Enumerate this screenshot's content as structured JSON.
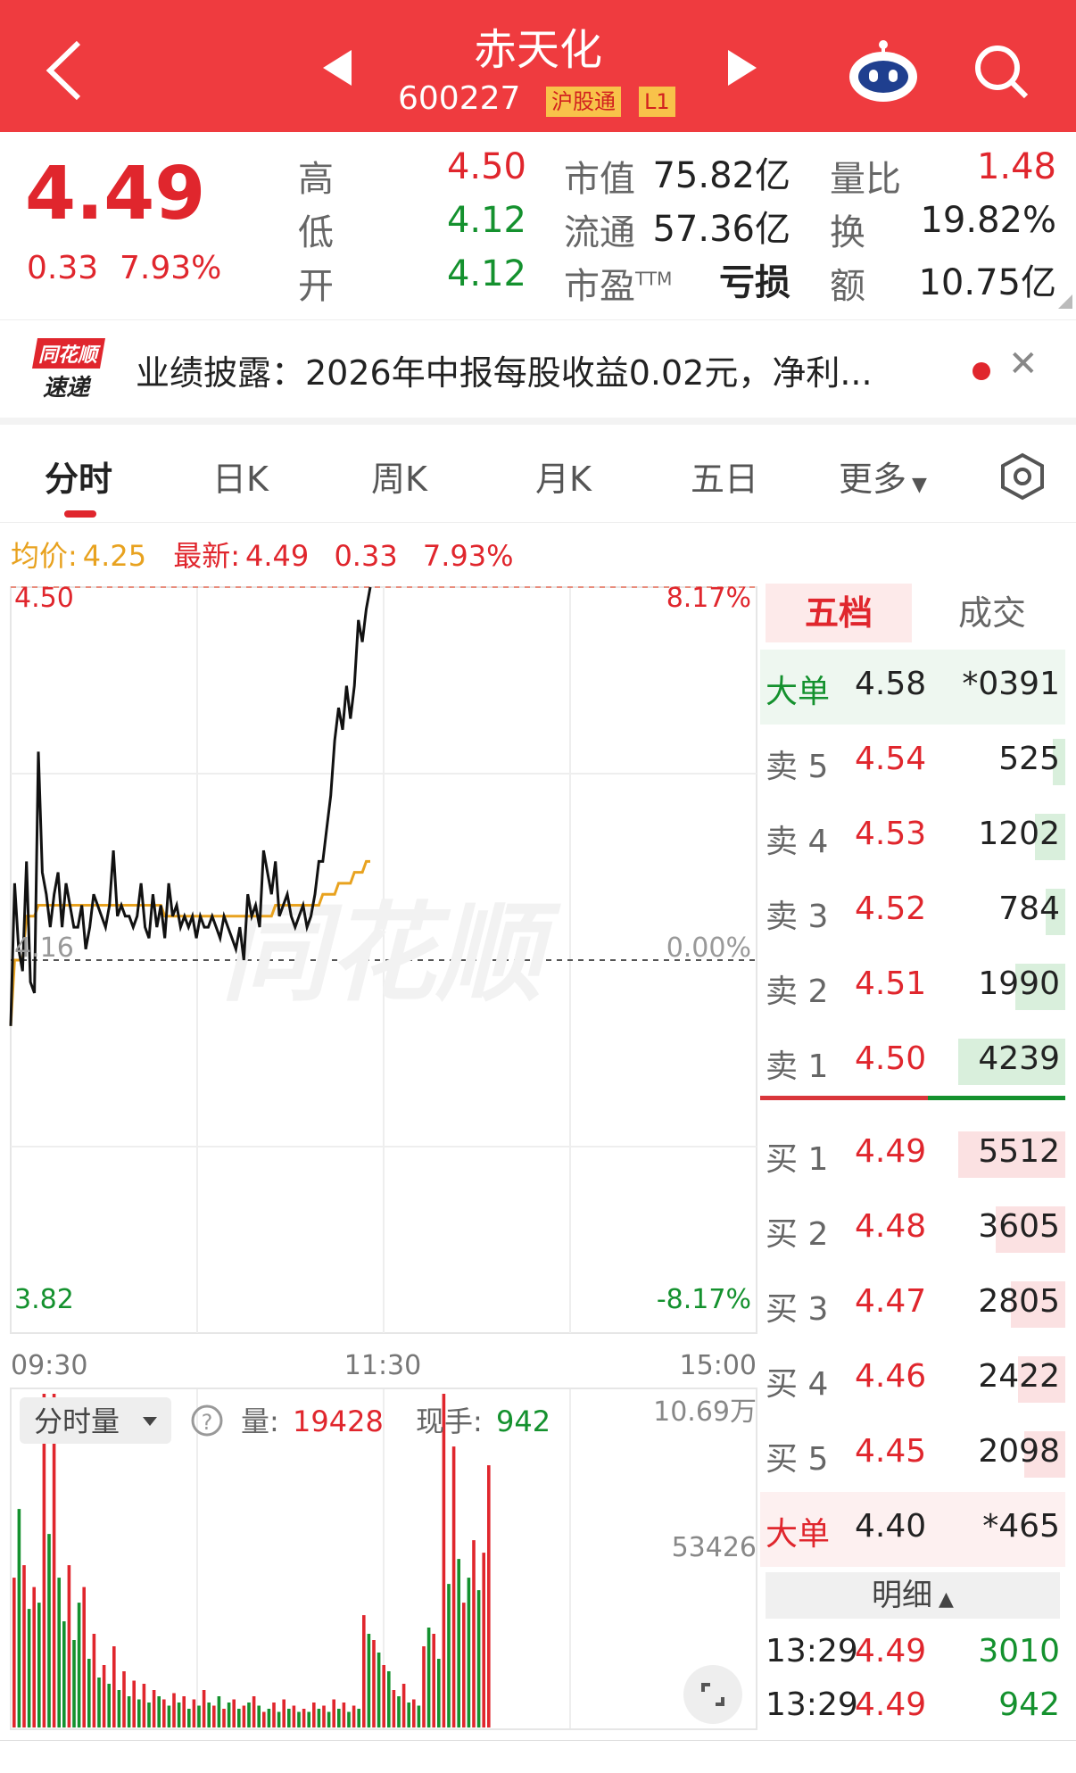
{
  "header": {
    "stock_name": "赤天化",
    "stock_code": "600227",
    "tag_connect": "沪股通",
    "tag_level": "L1"
  },
  "quote": {
    "price": "4.49",
    "change": "0.33",
    "change_pct": "7.93%",
    "high_label": "高",
    "high": "4.50",
    "low_label": "低",
    "low": "4.12",
    "open_label": "开",
    "open": "4.12",
    "mcap_label": "市值",
    "mcap": "75.82亿",
    "float_label": "流通",
    "float": "57.36亿",
    "pe_label": "市盈",
    "pe_sup": "TTM",
    "pe": "亏损",
    "vol_ratio_label": "量比",
    "vol_ratio": "1.48",
    "turnover_label": "换",
    "turnover": "19.82%",
    "amount_label": "额",
    "amount": "10.75亿"
  },
  "news": {
    "logo_line1": "同花顺",
    "logo_line2": "速递",
    "text": "业绩披露：2026年中报每股收益0.02元，净利..."
  },
  "tabs": [
    "分时",
    "日K",
    "周K",
    "月K",
    "五日",
    "更多"
  ],
  "avg_line": {
    "avg_label": "均价:",
    "avg_value": "4.25",
    "latest_label": "最新:",
    "latest_value": "4.49",
    "latest_change": "0.33",
    "latest_pct": "7.93%"
  },
  "chart_data": {
    "type": "line",
    "title": "",
    "ylim": [
      3.82,
      4.5
    ],
    "prev_close": 4.16,
    "y_labels_left": [
      "4.50",
      "4.16",
      "3.82"
    ],
    "y_labels_right": [
      "8.17%",
      "0.00%",
      "-8.17%"
    ],
    "x_labels": [
      "09:30",
      "11:30",
      "15:00"
    ],
    "series": [
      {
        "values": [
          4.1,
          4.23,
          4.17,
          4.15,
          4.25,
          4.14,
          4.13,
          4.35,
          4.24,
          4.22,
          4.19,
          4.22,
          4.24,
          4.19,
          4.23,
          4.21,
          4.19,
          4.19,
          4.21,
          4.17,
          4.19,
          4.22,
          4.21,
          4.2,
          4.19,
          4.21,
          4.26,
          4.2,
          4.21,
          4.2,
          4.2,
          4.19,
          4.2,
          4.23,
          4.19,
          4.18,
          4.22,
          4.19,
          4.21,
          4.18,
          4.23,
          4.2,
          4.21,
          4.19,
          4.2,
          4.19,
          4.2,
          4.18,
          4.2,
          4.19,
          4.19,
          4.2,
          4.19,
          4.18,
          4.2,
          4.19,
          4.18,
          4.17,
          4.19,
          4.16,
          4.22,
          4.2,
          4.21,
          4.19,
          4.26,
          4.24,
          4.22,
          4.25,
          4.2,
          4.21,
          4.22,
          4.2,
          4.19,
          4.2,
          4.21,
          4.19,
          4.2,
          4.22,
          4.25,
          4.25,
          4.28,
          4.31,
          4.36,
          4.39,
          4.37,
          4.41,
          4.38,
          4.41,
          4.47,
          4.45,
          4.48,
          4.5
        ],
        "avg": [
          4.1,
          4.16,
          4.16,
          4.16,
          4.2,
          4.2,
          4.2,
          4.21,
          4.21,
          4.21,
          4.21,
          4.21,
          4.21,
          4.21,
          4.21,
          4.21,
          4.21,
          4.21,
          4.21,
          4.21,
          4.21,
          4.21,
          4.21,
          4.21,
          4.21,
          4.21,
          4.21,
          4.21,
          4.21,
          4.21,
          4.21,
          4.21,
          4.21,
          4.21,
          4.21,
          4.21,
          4.21,
          4.21,
          4.21,
          4.2,
          4.2,
          4.2,
          4.2,
          4.2,
          4.2,
          4.2,
          4.2,
          4.2,
          4.2,
          4.2,
          4.2,
          4.2,
          4.2,
          4.2,
          4.2,
          4.2,
          4.2,
          4.2,
          4.2,
          4.2,
          4.2,
          4.2,
          4.2,
          4.2,
          4.2,
          4.2,
          4.2,
          4.21,
          4.21,
          4.21,
          4.21,
          4.21,
          4.21,
          4.21,
          4.21,
          4.21,
          4.21,
          4.21,
          4.21,
          4.22,
          4.22,
          4.22,
          4.22,
          4.23,
          4.23,
          4.23,
          4.23,
          4.24,
          4.24,
          4.24,
          4.25,
          4.25
        ]
      }
    ],
    "total_points": 241,
    "volume": {
      "selector_label": "分时量",
      "vol_label": "量:",
      "vol_value": "19428",
      "now_label": "现手:",
      "now_value": "942",
      "axis_top": "10.69万",
      "axis_mid": "53426",
      "max": 106900,
      "bars": [
        [
          48000,
          "r"
        ],
        [
          70000,
          "g"
        ],
        [
          52000,
          "r"
        ],
        [
          38000,
          "g"
        ],
        [
          45000,
          "r"
        ],
        [
          40000,
          "g"
        ],
        [
          106900,
          "r"
        ],
        [
          62000,
          "g"
        ],
        [
          106900,
          "r"
        ],
        [
          48000,
          "g"
        ],
        [
          34000,
          "g"
        ],
        [
          52000,
          "r"
        ],
        [
          28000,
          "g"
        ],
        [
          40000,
          "g"
        ],
        [
          45000,
          "r"
        ],
        [
          22000,
          "g"
        ],
        [
          30000,
          "r"
        ],
        [
          16000,
          "g"
        ],
        [
          20000,
          "r"
        ],
        [
          14000,
          "g"
        ],
        [
          26000,
          "r"
        ],
        [
          12000,
          "g"
        ],
        [
          18000,
          "r"
        ],
        [
          10000,
          "g"
        ],
        [
          15000,
          "r"
        ],
        [
          9000,
          "g"
        ],
        [
          14000,
          "r"
        ],
        [
          8000,
          "g"
        ],
        [
          12000,
          "r"
        ],
        [
          10000,
          "g"
        ],
        [
          9000,
          "r"
        ],
        [
          7000,
          "g"
        ],
        [
          11000,
          "r"
        ],
        [
          8000,
          "g"
        ],
        [
          10000,
          "r"
        ],
        [
          6000,
          "g"
        ],
        [
          9000,
          "r"
        ],
        [
          7000,
          "g"
        ],
        [
          12000,
          "r"
        ],
        [
          8000,
          "g"
        ],
        [
          7000,
          "r"
        ],
        [
          10000,
          "g"
        ],
        [
          6000,
          "r"
        ],
        [
          8000,
          "g"
        ],
        [
          9000,
          "r"
        ],
        [
          6000,
          "g"
        ],
        [
          7000,
          "r"
        ],
        [
          8000,
          "g"
        ],
        [
          10000,
          "r"
        ],
        [
          7000,
          "g"
        ],
        [
          5000,
          "r"
        ],
        [
          6000,
          "g"
        ],
        [
          8000,
          "r"
        ],
        [
          5000,
          "g"
        ],
        [
          9000,
          "r"
        ],
        [
          6000,
          "g"
        ],
        [
          7000,
          "r"
        ],
        [
          5000,
          "g"
        ],
        [
          6000,
          "r"
        ],
        [
          5000,
          "g"
        ],
        [
          8000,
          "r"
        ],
        [
          6000,
          "g"
        ],
        [
          7000,
          "r"
        ],
        [
          5000,
          "g"
        ],
        [
          9000,
          "r"
        ],
        [
          6000,
          "g"
        ],
        [
          8000,
          "r"
        ],
        [
          5000,
          "g"
        ],
        [
          7000,
          "r"
        ],
        [
          6000,
          "g"
        ],
        [
          36000,
          "r"
        ],
        [
          30000,
          "g"
        ],
        [
          28000,
          "r"
        ],
        [
          24000,
          "g"
        ],
        [
          20000,
          "r"
        ],
        [
          18000,
          "g"
        ],
        [
          12000,
          "r"
        ],
        [
          10000,
          "g"
        ],
        [
          14000,
          "r"
        ],
        [
          8000,
          "g"
        ],
        [
          9000,
          "r"
        ],
        [
          7000,
          "g"
        ],
        [
          26000,
          "r"
        ],
        [
          32000,
          "g"
        ],
        [
          30000,
          "r"
        ],
        [
          22000,
          "g"
        ],
        [
          106900,
          "r"
        ],
        [
          46000,
          "g"
        ],
        [
          90000,
          "r"
        ],
        [
          54000,
          "g"
        ],
        [
          40000,
          "r"
        ],
        [
          48000,
          "g"
        ],
        [
          60000,
          "r"
        ],
        [
          44000,
          "g"
        ],
        [
          56000,
          "r"
        ],
        [
          84000,
          "r"
        ]
      ]
    }
  },
  "orderbook": {
    "tab_active": "五档",
    "tab_other": "成交",
    "big_sell": {
      "label": "大单",
      "price": "4.58",
      "vol": "*0391"
    },
    "asks": [
      {
        "label": "卖 5",
        "price": "4.54",
        "vol": "525",
        "fill": 0.12
      },
      {
        "label": "卖 4",
        "price": "4.53",
        "vol": "1202",
        "fill": 0.28
      },
      {
        "label": "卖 3",
        "price": "4.52",
        "vol": "784",
        "fill": 0.18
      },
      {
        "label": "卖 2",
        "price": "4.51",
        "vol": "1990",
        "fill": 0.47
      },
      {
        "label": "卖 1",
        "price": "4.50",
        "vol": "4239",
        "fill": 1.0
      }
    ],
    "bids": [
      {
        "label": "买 1",
        "price": "4.49",
        "vol": "5512",
        "fill": 1.0
      },
      {
        "label": "买 2",
        "price": "4.48",
        "vol": "3605",
        "fill": 0.65
      },
      {
        "label": "买 3",
        "price": "4.47",
        "vol": "2805",
        "fill": 0.51
      },
      {
        "label": "买 4",
        "price": "4.46",
        "vol": "2422",
        "fill": 0.44
      },
      {
        "label": "买 5",
        "price": "4.45",
        "vol": "2098",
        "fill": 0.38
      }
    ],
    "big_buy": {
      "label": "大单",
      "price": "4.40",
      "vol": "*465"
    },
    "detail_label": "明细",
    "trades": [
      {
        "time": "13:29",
        "price": "4.49",
        "vol": "3010"
      },
      {
        "time": "13:29",
        "price": "4.49",
        "vol": "942"
      }
    ]
  },
  "colors": {
    "up": "#e0262d",
    "down": "#14912e",
    "avg": "#e8a21f",
    "header_bg": "#ef3b3f"
  }
}
